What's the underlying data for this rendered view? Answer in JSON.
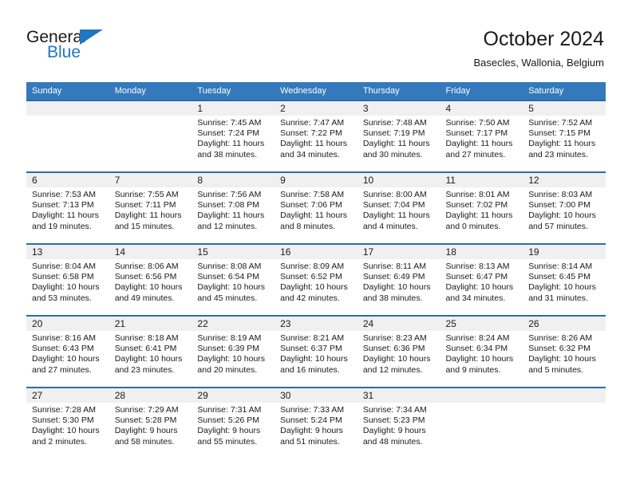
{
  "brand": {
    "name_part1": "General",
    "name_part2": "Blue",
    "accent_color": "#1f76c2"
  },
  "header": {
    "month_title": "October 2024",
    "location": "Basecles, Wallonia, Belgium"
  },
  "theme": {
    "header_bg": "#3479bb",
    "row_border": "#2e6da4",
    "daynum_band": "#f0f0f0"
  },
  "weekday_headers": [
    "Sunday",
    "Monday",
    "Tuesday",
    "Wednesday",
    "Thursday",
    "Friday",
    "Saturday"
  ],
  "weeks": [
    [
      {
        "day": "",
        "sunrise": "",
        "sunset": "",
        "daylight": "",
        "empty": true
      },
      {
        "day": "",
        "sunrise": "",
        "sunset": "",
        "daylight": "",
        "empty": true
      },
      {
        "day": "1",
        "sunrise": "Sunrise: 7:45 AM",
        "sunset": "Sunset: 7:24 PM",
        "daylight": "Daylight: 11 hours and 38 minutes."
      },
      {
        "day": "2",
        "sunrise": "Sunrise: 7:47 AM",
        "sunset": "Sunset: 7:22 PM",
        "daylight": "Daylight: 11 hours and 34 minutes."
      },
      {
        "day": "3",
        "sunrise": "Sunrise: 7:48 AM",
        "sunset": "Sunset: 7:19 PM",
        "daylight": "Daylight: 11 hours and 30 minutes."
      },
      {
        "day": "4",
        "sunrise": "Sunrise: 7:50 AM",
        "sunset": "Sunset: 7:17 PM",
        "daylight": "Daylight: 11 hours and 27 minutes."
      },
      {
        "day": "5",
        "sunrise": "Sunrise: 7:52 AM",
        "sunset": "Sunset: 7:15 PM",
        "daylight": "Daylight: 11 hours and 23 minutes."
      }
    ],
    [
      {
        "day": "6",
        "sunrise": "Sunrise: 7:53 AM",
        "sunset": "Sunset: 7:13 PM",
        "daylight": "Daylight: 11 hours and 19 minutes."
      },
      {
        "day": "7",
        "sunrise": "Sunrise: 7:55 AM",
        "sunset": "Sunset: 7:11 PM",
        "daylight": "Daylight: 11 hours and 15 minutes."
      },
      {
        "day": "8",
        "sunrise": "Sunrise: 7:56 AM",
        "sunset": "Sunset: 7:08 PM",
        "daylight": "Daylight: 11 hours and 12 minutes."
      },
      {
        "day": "9",
        "sunrise": "Sunrise: 7:58 AM",
        "sunset": "Sunset: 7:06 PM",
        "daylight": "Daylight: 11 hours and 8 minutes."
      },
      {
        "day": "10",
        "sunrise": "Sunrise: 8:00 AM",
        "sunset": "Sunset: 7:04 PM",
        "daylight": "Daylight: 11 hours and 4 minutes."
      },
      {
        "day": "11",
        "sunrise": "Sunrise: 8:01 AM",
        "sunset": "Sunset: 7:02 PM",
        "daylight": "Daylight: 11 hours and 0 minutes."
      },
      {
        "day": "12",
        "sunrise": "Sunrise: 8:03 AM",
        "sunset": "Sunset: 7:00 PM",
        "daylight": "Daylight: 10 hours and 57 minutes."
      }
    ],
    [
      {
        "day": "13",
        "sunrise": "Sunrise: 8:04 AM",
        "sunset": "Sunset: 6:58 PM",
        "daylight": "Daylight: 10 hours and 53 minutes."
      },
      {
        "day": "14",
        "sunrise": "Sunrise: 8:06 AM",
        "sunset": "Sunset: 6:56 PM",
        "daylight": "Daylight: 10 hours and 49 minutes."
      },
      {
        "day": "15",
        "sunrise": "Sunrise: 8:08 AM",
        "sunset": "Sunset: 6:54 PM",
        "daylight": "Daylight: 10 hours and 45 minutes."
      },
      {
        "day": "16",
        "sunrise": "Sunrise: 8:09 AM",
        "sunset": "Sunset: 6:52 PM",
        "daylight": "Daylight: 10 hours and 42 minutes."
      },
      {
        "day": "17",
        "sunrise": "Sunrise: 8:11 AM",
        "sunset": "Sunset: 6:49 PM",
        "daylight": "Daylight: 10 hours and 38 minutes."
      },
      {
        "day": "18",
        "sunrise": "Sunrise: 8:13 AM",
        "sunset": "Sunset: 6:47 PM",
        "daylight": "Daylight: 10 hours and 34 minutes."
      },
      {
        "day": "19",
        "sunrise": "Sunrise: 8:14 AM",
        "sunset": "Sunset: 6:45 PM",
        "daylight": "Daylight: 10 hours and 31 minutes."
      }
    ],
    [
      {
        "day": "20",
        "sunrise": "Sunrise: 8:16 AM",
        "sunset": "Sunset: 6:43 PM",
        "daylight": "Daylight: 10 hours and 27 minutes."
      },
      {
        "day": "21",
        "sunrise": "Sunrise: 8:18 AM",
        "sunset": "Sunset: 6:41 PM",
        "daylight": "Daylight: 10 hours and 23 minutes."
      },
      {
        "day": "22",
        "sunrise": "Sunrise: 8:19 AM",
        "sunset": "Sunset: 6:39 PM",
        "daylight": "Daylight: 10 hours and 20 minutes."
      },
      {
        "day": "23",
        "sunrise": "Sunrise: 8:21 AM",
        "sunset": "Sunset: 6:37 PM",
        "daylight": "Daylight: 10 hours and 16 minutes."
      },
      {
        "day": "24",
        "sunrise": "Sunrise: 8:23 AM",
        "sunset": "Sunset: 6:36 PM",
        "daylight": "Daylight: 10 hours and 12 minutes."
      },
      {
        "day": "25",
        "sunrise": "Sunrise: 8:24 AM",
        "sunset": "Sunset: 6:34 PM",
        "daylight": "Daylight: 10 hours and 9 minutes."
      },
      {
        "day": "26",
        "sunrise": "Sunrise: 8:26 AM",
        "sunset": "Sunset: 6:32 PM",
        "daylight": "Daylight: 10 hours and 5 minutes."
      }
    ],
    [
      {
        "day": "27",
        "sunrise": "Sunrise: 7:28 AM",
        "sunset": "Sunset: 5:30 PM",
        "daylight": "Daylight: 10 hours and 2 minutes."
      },
      {
        "day": "28",
        "sunrise": "Sunrise: 7:29 AM",
        "sunset": "Sunset: 5:28 PM",
        "daylight": "Daylight: 9 hours and 58 minutes."
      },
      {
        "day": "29",
        "sunrise": "Sunrise: 7:31 AM",
        "sunset": "Sunset: 5:26 PM",
        "daylight": "Daylight: 9 hours and 55 minutes."
      },
      {
        "day": "30",
        "sunrise": "Sunrise: 7:33 AM",
        "sunset": "Sunset: 5:24 PM",
        "daylight": "Daylight: 9 hours and 51 minutes."
      },
      {
        "day": "31",
        "sunrise": "Sunrise: 7:34 AM",
        "sunset": "Sunset: 5:23 PM",
        "daylight": "Daylight: 9 hours and 48 minutes."
      },
      {
        "day": "",
        "sunrise": "",
        "sunset": "",
        "daylight": "",
        "empty": true
      },
      {
        "day": "",
        "sunrise": "",
        "sunset": "",
        "daylight": "",
        "empty": true
      }
    ]
  ]
}
